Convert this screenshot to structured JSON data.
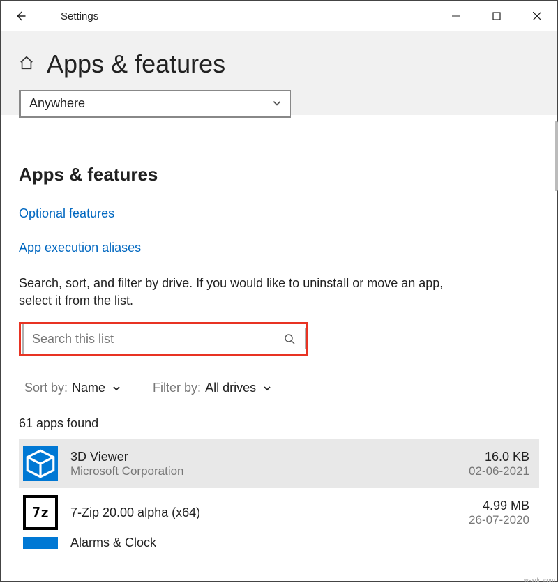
{
  "titlebar": {
    "title": "Settings"
  },
  "header": {
    "page_title": "Apps & features"
  },
  "install_source": {
    "value": "Anywhere"
  },
  "section": {
    "title": "Apps & features",
    "links": {
      "optional_features": "Optional features",
      "app_execution_aliases": "App execution aliases"
    },
    "help_text": "Search, sort, and filter by drive. If you would like to uninstall or move an app, select it from the list."
  },
  "search": {
    "placeholder": "Search this list"
  },
  "sort": {
    "label": "Sort by:",
    "value": "Name"
  },
  "filter": {
    "label": "Filter by:",
    "value": "All drives"
  },
  "count_text": "61 apps found",
  "apps": [
    {
      "name": "3D Viewer",
      "publisher": "Microsoft Corporation",
      "size": "16.0 KB",
      "date": "02-06-2021"
    },
    {
      "name": "7-Zip 20.00 alpha (x64)",
      "publisher": "",
      "size": "4.99 MB",
      "date": "26-07-2020"
    },
    {
      "name": "Alarms & Clock",
      "publisher": "",
      "size": "",
      "date": ""
    }
  ],
  "watermark": "wsxdn.com"
}
